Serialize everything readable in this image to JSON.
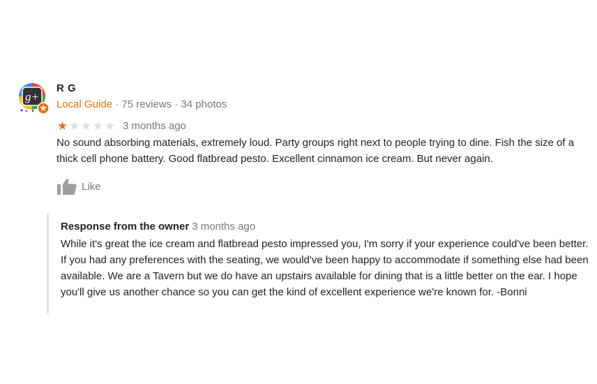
{
  "reviewer": {
    "name": "R G",
    "badge": "Local Guide",
    "separator": " · ",
    "reviews_count": "75 reviews",
    "photos_count": "34 photos",
    "avatar_icon": "google-plus-local-guide-avatar"
  },
  "rating": {
    "value": 1,
    "max": 5,
    "filled_color": "#e7711b",
    "empty_color": "#dddddd"
  },
  "review": {
    "date": "3 months ago",
    "text": "No sound absorbing materials, extremely loud. Party groups right next to people trying to dine. Fish the size of a thick cell phone battery. Good flatbread pesto. Excellent cinnamon ice cream. But never again."
  },
  "like": {
    "label": "Like",
    "icon": "thumbs-up-icon"
  },
  "owner_response": {
    "title": "Response from the owner",
    "date": "3 months ago",
    "text": "While it's great the ice cream and flatbread pesto impressed you, I'm sorry if your experience could've been better. If you had any preferences with the seating, we would've been happy to accommodate if something else had been available. We are a Tavern but we do have an upstairs available for dining that is a little better on the ear. I hope you'll give us another chance so you can get the kind of excellent experience we're known for. -Bonni"
  },
  "colors": {
    "accent": "#e8710a",
    "text": "#222222",
    "muted": "#777777",
    "response_border": "#e0e0e0"
  }
}
